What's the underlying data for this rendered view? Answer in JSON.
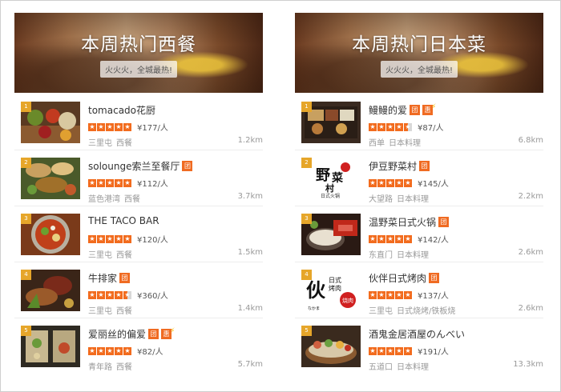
{
  "columns": [
    {
      "banner": {
        "title": "本周热门西餐",
        "tag": "火火火，全城最热!"
      },
      "items": [
        {
          "rank": "1",
          "name": "tomacado花厨",
          "rating": 5,
          "price": "¥177/人",
          "area": "三里屯",
          "cuisine": "西餐",
          "distance": "1.2km",
          "badges": [],
          "flash": false
        },
        {
          "rank": "2",
          "name": "solounge索兰至餐厅",
          "rating": 5,
          "price": "¥112/人",
          "area": "蓝色港湾",
          "cuisine": "西餐",
          "distance": "3.7km",
          "badges": [
            "团"
          ],
          "flash": false
        },
        {
          "rank": "3",
          "name": "THE TACO BAR",
          "rating": 5,
          "price": "¥120/人",
          "area": "三里屯",
          "cuisine": "西餐",
          "distance": "1.5km",
          "badges": [],
          "flash": false
        },
        {
          "rank": "4",
          "name": "牛排家",
          "rating": 4.5,
          "price": "¥360/人",
          "area": "三里屯",
          "cuisine": "西餐",
          "distance": "1.4km",
          "badges": [
            "团"
          ],
          "flash": false
        },
        {
          "rank": "5",
          "name": "爱丽丝的偏爱",
          "rating": 5,
          "price": "¥82/人",
          "area": "青年路",
          "cuisine": "西餐",
          "distance": "5.7km",
          "badges": [
            "团",
            "惠"
          ],
          "flash": true
        }
      ]
    },
    {
      "banner": {
        "title": "本周热门日本菜",
        "tag": "火火火，全城最热!"
      },
      "items": [
        {
          "rank": "1",
          "name": "鳗鳗的爱",
          "rating": 4.5,
          "price": "¥87/人",
          "area": "西单",
          "cuisine": "日本料理",
          "distance": "6.8km",
          "badges": [
            "团",
            "惠"
          ],
          "flash": true
        },
        {
          "rank": "2",
          "name": "伊豆野菜村",
          "rating": 5,
          "price": "¥145/人",
          "area": "大望路",
          "cuisine": "日本料理",
          "distance": "2.2km",
          "badges": [
            "团"
          ],
          "flash": false
        },
        {
          "rank": "3",
          "name": "温野菜日式火锅",
          "rating": 5,
          "price": "¥142/人",
          "area": "东直门",
          "cuisine": "日本料理",
          "distance": "2.6km",
          "badges": [
            "团"
          ],
          "flash": false
        },
        {
          "rank": "4",
          "name": "伙伴日式烤肉",
          "rating": 5,
          "price": "¥137/人",
          "area": "三里屯",
          "cuisine": "日式烧烤/铁板烧",
          "distance": "2.6km",
          "badges": [
            "团"
          ],
          "flash": false
        },
        {
          "rank": "5",
          "name": "酒鬼金居酒屋のんべい",
          "rating": 5,
          "price": "¥191/人",
          "area": "五道口",
          "cuisine": "日本料理",
          "distance": "13.3km",
          "badges": [],
          "flash": false
        }
      ]
    }
  ],
  "colors": {
    "accent": "#f26b1d",
    "rank_badge": "#e6a62a",
    "badge": "#f06b22"
  },
  "logos": {
    "izu": "野菜村 日式火锅",
    "banban": "伙伴 日式烤肉 なかま 烧肉"
  }
}
